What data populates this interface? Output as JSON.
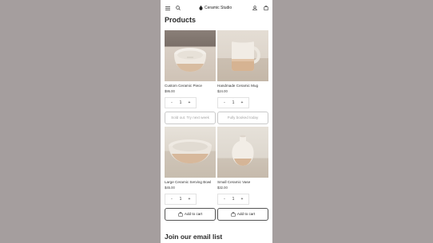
{
  "header": {
    "menu_icon": "hamburger-menu-icon",
    "search_icon": "search-icon",
    "brand_icon": "vase-logo-icon",
    "brand_name": "Ceramic Studio",
    "account_icon": "user-icon",
    "cart_icon": "shopping-bag-icon"
  },
  "page_title": "Products",
  "products": [
    {
      "name": "Custom Ceramic Piece",
      "price": "$95.00",
      "quantity": "1",
      "decrement": "-",
      "increment": "+",
      "action_label": "Sold out. Try next week",
      "action_enabled": false
    },
    {
      "name": "Handmade Ceramic Mug",
      "price": "$24.00",
      "quantity": "1",
      "decrement": "-",
      "increment": "+",
      "action_label": "Fully booked today",
      "action_enabled": false
    },
    {
      "name": "Large Ceramic Serving Bowl",
      "price": "$45.00",
      "quantity": "1",
      "decrement": "-",
      "increment": "+",
      "action_label": "Add to cart",
      "action_icon": "cart-icon",
      "action_enabled": true
    },
    {
      "name": "Small Ceramic Vase",
      "price": "$32.00",
      "quantity": "1",
      "decrement": "-",
      "increment": "+",
      "action_label": "Add to cart",
      "action_icon": "cart-icon",
      "action_enabled": true
    }
  ],
  "newsletter": {
    "title": "Join our email list"
  },
  "colors": {
    "backdrop": "#a59e9e",
    "surface": "#ffffff",
    "text": "#222222",
    "disabled_text": "#a3a3a3"
  }
}
